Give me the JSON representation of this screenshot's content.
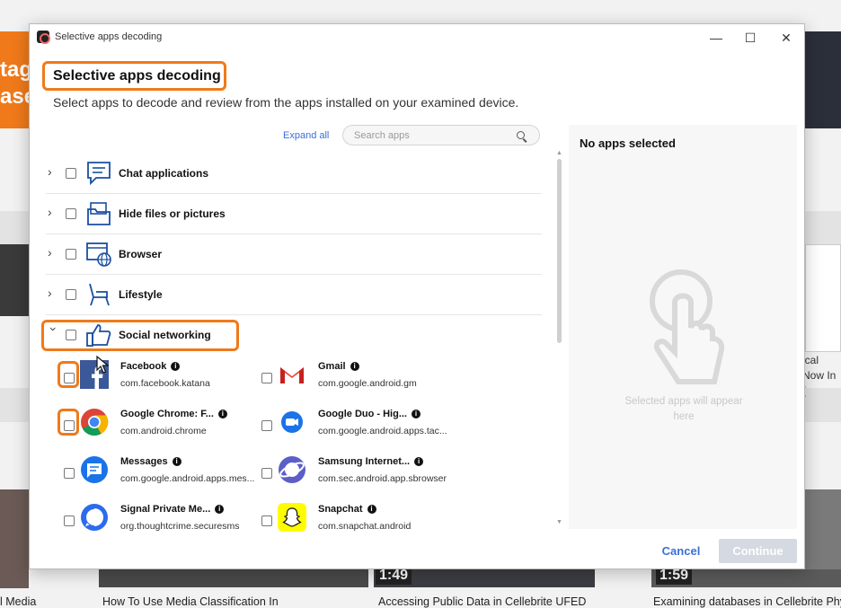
{
  "background": {
    "banner_partial": "tag ase",
    "right_caption_partial": "ical Now In (",
    "captions": [
      "l Media",
      "How To Use Media Classification In",
      "Accessing Public Data in Cellebrite UFED",
      "Examining databases in Cellebrite Phy"
    ],
    "durations": [
      "1:49",
      "1:59"
    ]
  },
  "window": {
    "title": "Selective apps decoding",
    "minimize": "—",
    "maximize": "☐",
    "close": "✕"
  },
  "heading": "Selective apps decoding",
  "subtitle": "Select apps to decode and review from the apps installed on your examined device.",
  "toolbar": {
    "expand_all": "Expand all",
    "search_placeholder": "Search apps"
  },
  "categories": [
    {
      "label": "Chat applications",
      "icon": "chat-icon"
    },
    {
      "label": "Hide files or pictures",
      "icon": "folder-icon"
    },
    {
      "label": "Browser",
      "icon": "browser-icon"
    },
    {
      "label": "Lifestyle",
      "icon": "chair-icon"
    },
    {
      "label": "Social networking",
      "icon": "thumbs-up-icon",
      "expanded": true
    }
  ],
  "apps": [
    {
      "name": "Facebook",
      "package": "com.facebook.katana",
      "icon": "facebook-icon",
      "color": "#3b5998"
    },
    {
      "name": "Gmail",
      "package": "com.google.android.gm",
      "icon": "gmail-icon",
      "color": "#ea4335"
    },
    {
      "name": "Google Chrome: F...",
      "package": "com.android.chrome",
      "icon": "chrome-icon",
      "color": "#4285f4"
    },
    {
      "name": "Google Duo - Hig...",
      "package": "com.google.android.apps.tac...",
      "icon": "duo-icon",
      "color": "#1a73e8"
    },
    {
      "name": "Messages",
      "package": "com.google.android.apps.mes...",
      "icon": "messages-icon",
      "color": "#1a73e8"
    },
    {
      "name": "Samsung Internet...",
      "package": "com.sec.android.app.sbrowser",
      "icon": "samsung-internet-icon",
      "color": "#5b5fc7"
    },
    {
      "name": "Signal Private Me...",
      "package": "org.thoughtcrime.securesms",
      "icon": "signal-icon",
      "color": "#2c6bed"
    },
    {
      "name": "Snapchat",
      "package": "com.snapchat.android",
      "icon": "snapchat-icon",
      "color": "#fffc00"
    }
  ],
  "right_panel": {
    "title": "No apps selected",
    "placeholder": "Selected apps will appear here"
  },
  "buttons": {
    "cancel": "Cancel",
    "continue": "Continue"
  },
  "colors": {
    "highlight": "#f07a1a",
    "link": "#3b6fd6",
    "continue_disabled": "#d4d9e2"
  }
}
